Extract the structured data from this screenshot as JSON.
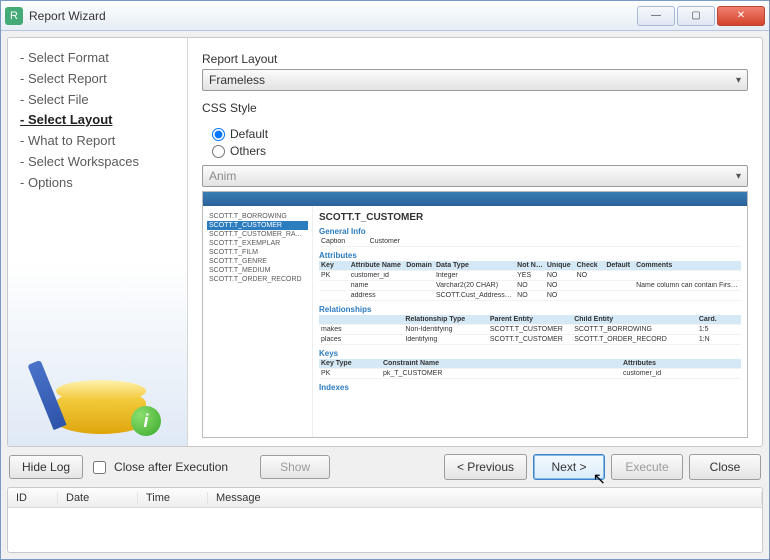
{
  "window": {
    "title": "Report Wizard"
  },
  "steps": {
    "items": [
      "Select Format",
      "Select Report",
      "Select File",
      "Select Layout",
      "What to Report",
      "Select Workspaces",
      "Options"
    ],
    "selected_index": 3
  },
  "layout": {
    "section_label": "Report Layout",
    "selected": "Frameless",
    "css_label": "CSS Style",
    "radio_default": "Default",
    "radio_others": "Others",
    "radio_value": "default",
    "css_selected": "Anim"
  },
  "preview": {
    "nav": [
      "SCOTT.T_BORROWING",
      "SCOTT.T_CUSTOMER",
      "SCOTT.T_CUSTOMER_RATING",
      "SCOTT.T_EXEMPLAR",
      "SCOTT.T_FILM",
      "SCOTT.T_GENRE",
      "SCOTT.T_MEDIUM",
      "SCOTT.T_ORDER_RECORD"
    ],
    "nav_selected": 1,
    "title": "SCOTT.T_CUSTOMER",
    "general_info": {
      "label": "General Info",
      "caption_lbl": "Caption",
      "caption_val": "Customer"
    },
    "attributes": {
      "label": "Attributes",
      "cols": [
        "Key",
        "Attribute Name",
        "Domain",
        "Data Type",
        "Not Null",
        "Unique",
        "Check",
        "Default",
        "Comments"
      ],
      "rows": [
        [
          "PK",
          "customer_id",
          "",
          "Integer",
          "YES",
          "NO",
          "NO",
          "",
          ""
        ],
        [
          "",
          "name",
          "",
          "Varchar2(20 CHAR)",
          "NO",
          "NO",
          "",
          "",
          "Name column can contain First and Middle name. Surname must be in different column."
        ],
        [
          "",
          "address",
          "",
          "SCOTT.Cust_Address_Type",
          "NO",
          "NO",
          "",
          "",
          ""
        ]
      ]
    },
    "relationships": {
      "label": "Relationships",
      "cols": [
        "",
        "Relationship Type",
        "Parent Entity",
        "Child Entity",
        "Card."
      ],
      "rows": [
        [
          "makes",
          "Non-Identifying",
          "SCOTT.T_CUSTOMER",
          "SCOTT.T_BORROWING",
          "1:5"
        ],
        [
          "places",
          "Identifying",
          "SCOTT.T_CUSTOMER",
          "SCOTT.T_ORDER_RECORD",
          "1:N"
        ]
      ]
    },
    "keys": {
      "label": "Keys",
      "cols": [
        "Key Type",
        "Constraint Name",
        "",
        "Attributes"
      ],
      "rows": [
        [
          "PK",
          "pk_T_CUSTOMER",
          "",
          "customer_id"
        ]
      ]
    },
    "indexes_label": "Indexes"
  },
  "buttons": {
    "hide_log": "Hide Log",
    "close_after": "Close after Execution",
    "show": "Show",
    "previous": "< Previous",
    "next": "Next >",
    "execute": "Execute",
    "close": "Close"
  },
  "log": {
    "cols": {
      "id": "ID",
      "date": "Date",
      "time": "Time",
      "message": "Message"
    }
  }
}
